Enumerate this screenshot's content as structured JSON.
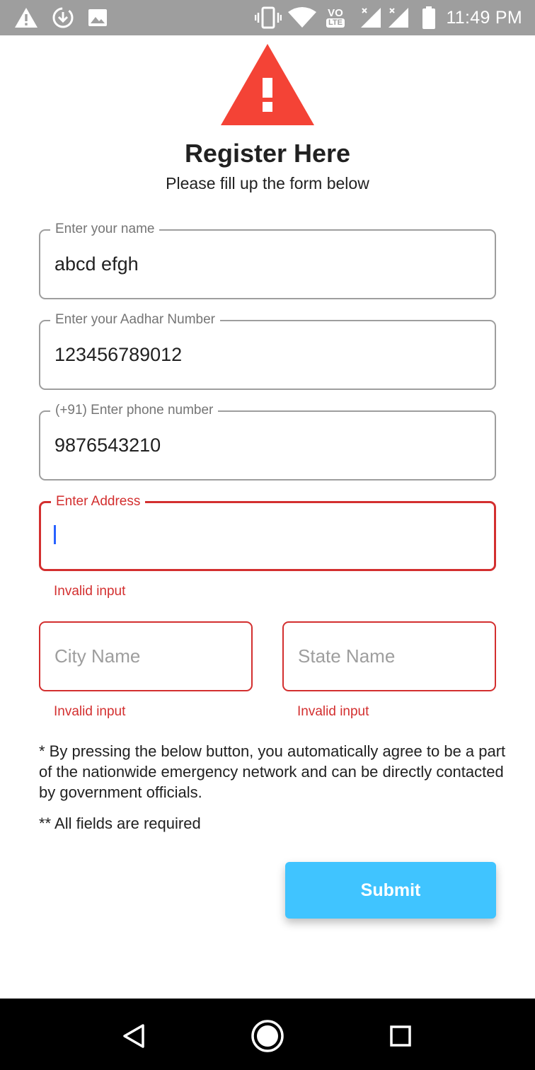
{
  "status_bar": {
    "time": "11:49 PM",
    "left_icons": [
      "alert-icon",
      "download-icon",
      "image-icon"
    ],
    "right_icons": [
      "vibrate-icon",
      "wifi-icon",
      "volte-icon",
      "signal-icon",
      "signal-icon",
      "battery-icon"
    ],
    "volte_label_top": "VO",
    "volte_label_bottom": "LTE"
  },
  "header": {
    "icon": "warning-icon",
    "icon_color": "#f44336",
    "title": "Register Here",
    "subtitle": "Please fill up the form below"
  },
  "form": {
    "name": {
      "label": "Enter your name",
      "value": "abcd efgh"
    },
    "aadhar": {
      "label": "Enter your Aadhar Number",
      "value": "123456789012"
    },
    "phone": {
      "label": "(+91) Enter phone number",
      "value": "9876543210"
    },
    "address": {
      "label": "Enter Address",
      "value": "",
      "error": "Invalid input"
    },
    "city": {
      "placeholder": "City Name",
      "error": "Invalid input"
    },
    "state": {
      "placeholder": "State Name",
      "error": "Invalid input"
    }
  },
  "notice": "* By pressing the below button, you automatically agree to be a part of the nationwide emergency network and can be directly contacted by government officials.",
  "required_note": "** All fields are required",
  "submit": {
    "label": "Submit",
    "color": "#40c4ff"
  },
  "nav_bar": {
    "icons": [
      "back-icon",
      "home-icon",
      "recents-icon"
    ]
  },
  "colors": {
    "error": "#d32f2f",
    "status_bar": "#9e9e9e",
    "cursor": "#2962ff"
  }
}
